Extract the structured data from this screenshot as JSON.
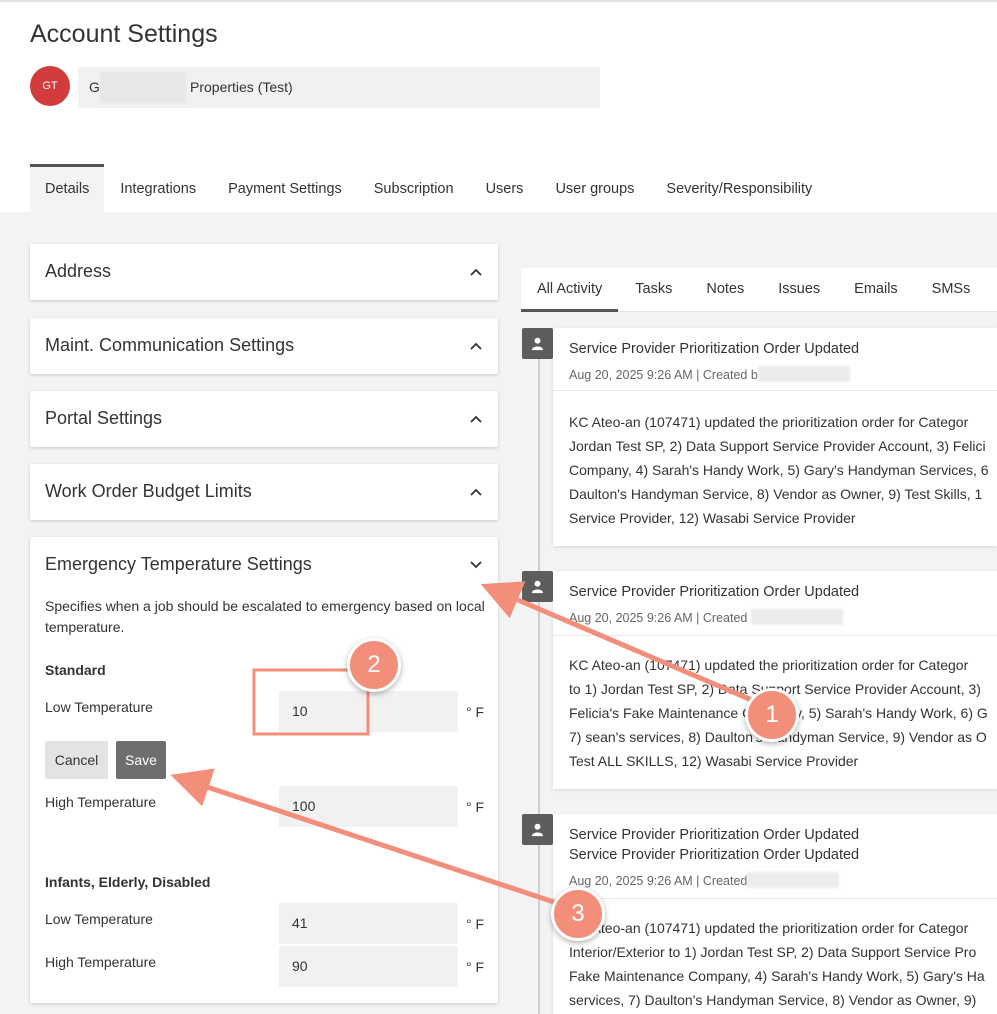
{
  "page": {
    "title": "Account Settings",
    "avatar_initials": "GT",
    "company_prefix": "G",
    "company_suffix": "Properties (Test)"
  },
  "tabs": [
    {
      "label": "Details",
      "active": true
    },
    {
      "label": "Integrations"
    },
    {
      "label": "Payment Settings"
    },
    {
      "label": "Subscription"
    },
    {
      "label": "Users"
    },
    {
      "label": "User groups"
    },
    {
      "label": "Severity/Responsibility"
    }
  ],
  "panels": {
    "address": "Address",
    "maint_comm": "Maint. Communication Settings",
    "portal": "Portal Settings",
    "budget": "Work Order Budget Limits",
    "emergency": {
      "title": "Emergency Temperature Settings",
      "description": "Specifies when a job should be escalated to emergency based on local temperature.",
      "standard": {
        "heading": "Standard",
        "low_label": "Low Temperature",
        "low_value": "10",
        "high_label": "High Temperature",
        "high_value": "100"
      },
      "vulnerable": {
        "heading": "Infants, Elderly, Disabled",
        "low_label": "Low Temperature",
        "low_value": "41",
        "high_label": "High Temperature",
        "high_value": "90"
      },
      "unit": "° F",
      "cancel_label": "Cancel",
      "save_label": "Save"
    }
  },
  "activity": {
    "tabs": [
      "All Activity",
      "Tasks",
      "Notes",
      "Issues",
      "Emails",
      "SMSs"
    ],
    "items": [
      {
        "title": "Service Provider Prioritization Order Updated",
        "meta": "Aug 20, 2025 9:26 AM | Created b",
        "lines": [
          "KC Ateo-an (107471) updated the prioritization order for Categor",
          "Jordan Test SP, 2) Data Support Service Provider Account, 3) Felici",
          "Company, 4) Sarah's Handy Work, 5) Gary's Handyman Services, 6",
          "Daulton's Handyman Service, 8) Vendor as Owner, 9) Test Skills, 1",
          "Service Provider, 12) Wasabi Service Provider"
        ]
      },
      {
        "title": "Service Provider Prioritization Order Updated",
        "meta": "Aug 20, 2025 9:26 AM | Created",
        "lines": [
          "KC Ateo-an (107471) updated the prioritization order for Categor",
          "to 1) Jordan Test SP, 2) Data Support Service Provider Account, 3)",
          "Felicia's Fake Maintenance Company, 5) Sarah's Handy Work, 6) G",
          "7) sean's services, 8) Daulton's Handyman Service, 9) Vendor as O",
          "Test ALL SKILLS, 12) Wasabi Service Provider"
        ]
      },
      {
        "title": "Service Provider Prioritization Order Updated",
        "title2": "Service Provider Prioritization Order Updated",
        "meta": "Aug 20, 2025 9:26 AM | Created",
        "lines": [
          "KC Ateo-an (107471) updated the prioritization order for Categor",
          "Interior/Exterior to 1) Jordan Test SP, 2) Data Support Service Pro",
          "Fake Maintenance Company, 4) Sarah's Handy Work, 5) Gary's Ha",
          "services, 7) Daulton's Handyman Service, 8) Vendor as Owner, 9)"
        ]
      }
    ]
  },
  "annotations": {
    "badge_1": "1",
    "badge_2": "2",
    "badge_3": "3",
    "color": "#f28e7a"
  }
}
